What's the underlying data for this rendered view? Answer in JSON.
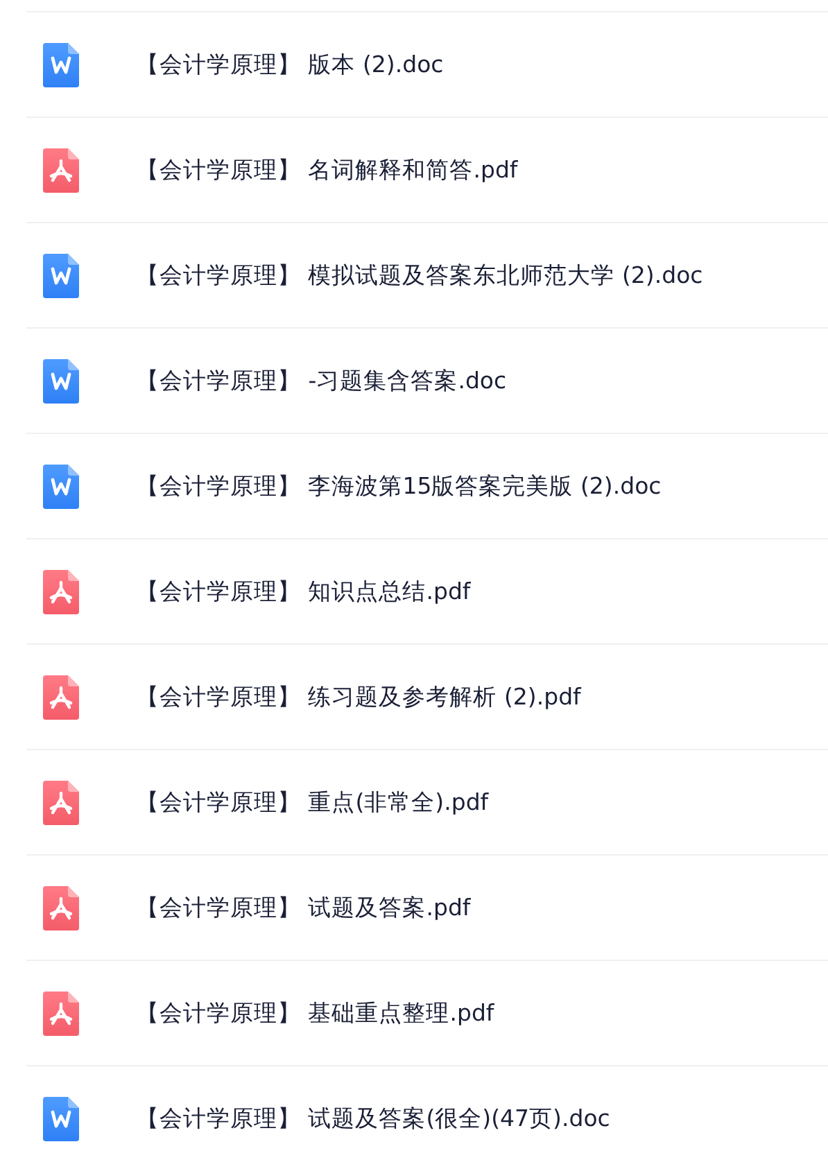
{
  "files": [
    {
      "kind": "doc",
      "name": "【会计学原理】 版本 (2).doc"
    },
    {
      "kind": "pdf",
      "name": "【会计学原理】 名词解释和简答.pdf"
    },
    {
      "kind": "doc",
      "name": "【会计学原理】 模拟试题及答案东北师范大学 (2).doc"
    },
    {
      "kind": "doc",
      "name": "【会计学原理】 -习题集含答案.doc"
    },
    {
      "kind": "doc",
      "name": "【会计学原理】 李海波第15版答案完美版 (2).doc"
    },
    {
      "kind": "pdf",
      "name": "【会计学原理】 知识点总结.pdf"
    },
    {
      "kind": "pdf",
      "name": "【会计学原理】 练习题及参考解析 (2).pdf"
    },
    {
      "kind": "pdf",
      "name": "【会计学原理】 重点(非常全).pdf"
    },
    {
      "kind": "pdf",
      "name": "【会计学原理】 试题及答案.pdf"
    },
    {
      "kind": "pdf",
      "name": "【会计学原理】 基础重点整理.pdf"
    },
    {
      "kind": "doc",
      "name": "【会计学原理】 试题及答案(很全)(47页).doc"
    }
  ]
}
